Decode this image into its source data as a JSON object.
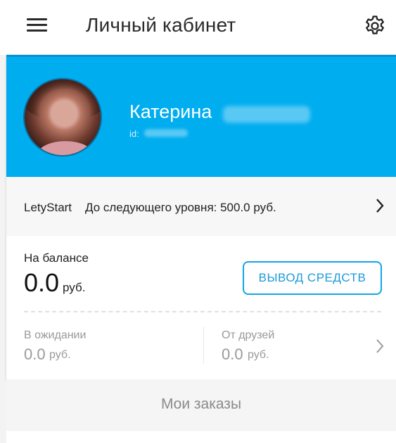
{
  "header": {
    "title": "Личный кабинет",
    "menu_icon": "hamburger-menu-icon",
    "settings_icon": "gear-icon"
  },
  "profile": {
    "name": "Катерина",
    "id_label": "id:",
    "background_color": "#00adef"
  },
  "level": {
    "name": "LetyStart",
    "text": "До следующего уровня: 500.0 руб."
  },
  "balance": {
    "label": "На балансе",
    "amount": "0.0",
    "currency": "руб.",
    "withdraw_label": "ВЫВОД СРЕДСТВ",
    "pending_label": "В ожидании",
    "pending_amount": "0.0",
    "pending_currency": "руб.",
    "friends_label": "От друзей",
    "friends_amount": "0.0",
    "friends_currency": "руб."
  },
  "orders": {
    "label": "Мои заказы"
  }
}
